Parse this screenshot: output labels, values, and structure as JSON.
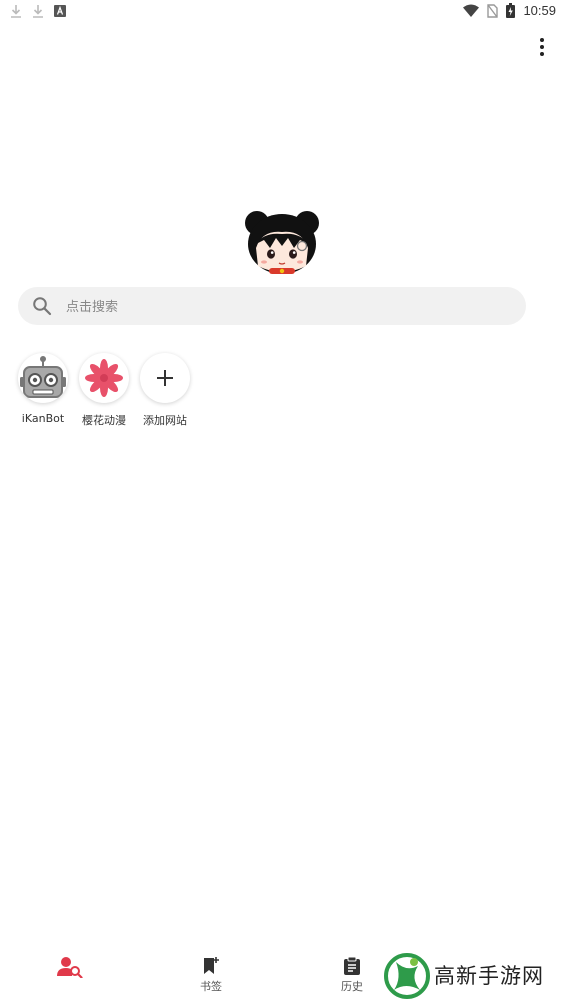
{
  "status_bar": {
    "time": "10:59",
    "icons": [
      "download-icon",
      "download-icon",
      "a-icon",
      "wifi-icon",
      "no-sim-icon",
      "battery-charging-icon"
    ]
  },
  "header": {
    "menu_icon": "more-vert-icon"
  },
  "search": {
    "placeholder": "点击搜索"
  },
  "shortcuts": [
    {
      "label": "iKanBot",
      "icon": "robot-icon"
    },
    {
      "label": "樱花动漫",
      "icon": "flower-icon"
    },
    {
      "label": "添加网站",
      "icon": "plus-icon"
    }
  ],
  "bottom_nav": {
    "items": [
      {
        "label": "",
        "icon": "user-search-icon",
        "active": true
      },
      {
        "label": "书签",
        "icon": "bookmark-icon"
      },
      {
        "label": "历史",
        "icon": "history-icon"
      }
    ]
  },
  "watermark": {
    "text": "高新手游网"
  },
  "colors": {
    "accent": "#e0394a",
    "search_bg": "#f1f1f1"
  }
}
